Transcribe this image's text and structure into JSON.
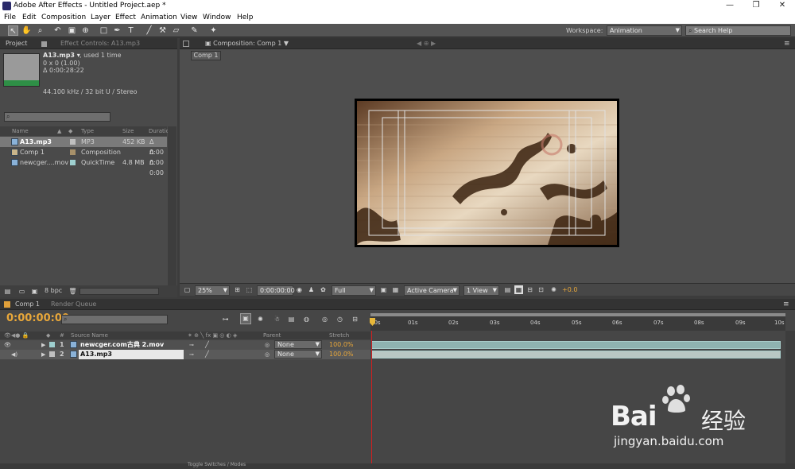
{
  "window": {
    "title": "Adobe After Effects - Untitled Project.aep *",
    "min": "—",
    "max": "❐",
    "close": "✕"
  },
  "menu": [
    "File",
    "Edit",
    "Composition",
    "Layer",
    "Effect",
    "Animation",
    "View",
    "Window",
    "Help"
  ],
  "toolbar": {
    "workspace_label": "Workspace:",
    "workspace_value": "Animation",
    "search_placeholder": "Search Help"
  },
  "project_panel": {
    "tab_project": "Project",
    "tab_effect_controls": "Effect Controls: A13.mp3",
    "selected_name": "A13.mp3 ▾",
    "used_text": ", used 1 time",
    "dims": "0 x 0 (1.00)",
    "duration": "Δ 0:00:28:22",
    "audio_info": "44.100 kHz / 32 bit U / Stereo",
    "columns": {
      "name": "Name",
      "type": "Type",
      "size": "Size",
      "duration": "Duration"
    },
    "items": [
      {
        "name": "A13.mp3",
        "type": "MP3",
        "size": "452 KB",
        "duration": "Δ 0:00",
        "swatch": "#bfbfbf"
      },
      {
        "name": "Comp 1",
        "type": "Composition",
        "size": "",
        "duration": "Δ 0:00",
        "swatch": "#a8916a"
      },
      {
        "name": "newcger....mov",
        "type": "QuickTime",
        "size": "4.8 MB",
        "duration": "Δ 0:00",
        "swatch": "#9ecfcf"
      }
    ],
    "bpc": "8 bpc"
  },
  "comp_panel": {
    "tab": "Composition: Comp 1",
    "subtab": "Comp 1",
    "zoom": "25%",
    "timecode": "0:00:00:00",
    "resolution": "Full",
    "camera": "Active Camera",
    "view": "1 View",
    "exposure": "+0.0"
  },
  "timeline": {
    "tab_comp": "Comp 1",
    "tab_render": "Render Queue",
    "timecode": "0:00:00:00",
    "col_source": "Source Name",
    "col_parent": "Parent",
    "col_stretch": "Stretch",
    "ruler": [
      "00s",
      "01s",
      "02s",
      "03s",
      "04s",
      "05s",
      "06s",
      "07s",
      "08s",
      "09s",
      "10s"
    ],
    "layers": [
      {
        "num": "1",
        "name": "newcger.com古典 2.mov",
        "parent": "None",
        "stretch": "100.0%"
      },
      {
        "num": "2",
        "name": "A13.mp3",
        "parent": "None",
        "stretch": "100.0%"
      }
    ],
    "toggle_label": "Toggle Switches / Modes"
  },
  "watermark": {
    "brand": "Bai",
    "brand2": "经验",
    "url": "jingyan.baidu.com"
  },
  "colors": {
    "accent_timecode": "#e8a73a",
    "track": "#8fb3b0"
  }
}
